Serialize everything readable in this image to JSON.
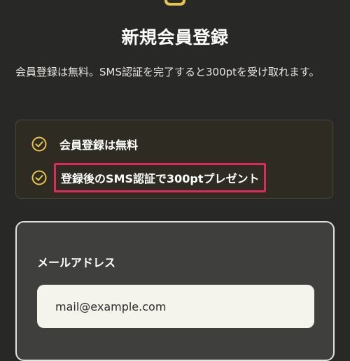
{
  "header": {
    "icon": "lock-icon",
    "title": "新規会員登録",
    "description": "会員登録は無料。SMS認証を完了すると300ptを受け取れます。"
  },
  "benefits": {
    "icon": "check-circle-icon",
    "accent_color": "#e6c44d",
    "highlight_color": "#e0285a",
    "items": [
      {
        "label": "会員登録は無料"
      },
      {
        "label": "登録後のSMS認証で300ptプレゼント"
      }
    ]
  },
  "form": {
    "email_label": "メールアドレス",
    "email_value": "mail@example.com"
  }
}
